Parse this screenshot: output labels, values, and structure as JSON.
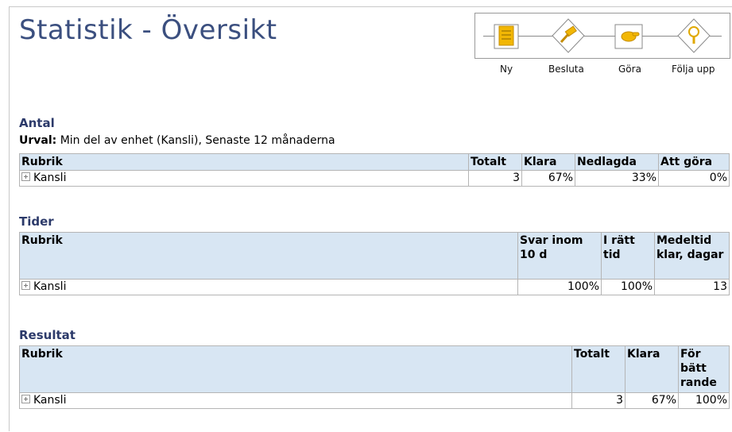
{
  "page": {
    "title": "Statistik - Översikt"
  },
  "process": {
    "steps": [
      {
        "label": "Ny",
        "icon": "document-icon"
      },
      {
        "label": "Besluta",
        "icon": "gavel-icon"
      },
      {
        "label": "Göra",
        "icon": "hand-icon"
      },
      {
        "label": "Följa upp",
        "icon": "magnifier-icon"
      }
    ],
    "icon_color": "#f2b705"
  },
  "antal": {
    "title": "Antal",
    "selection_label": "Urval:",
    "selection_value": "Min del av enhet (Kansli), Senaste 12 månaderna",
    "headers": [
      "Rubrik",
      "Totalt",
      "Klara",
      "Nedlagda",
      "Att göra"
    ],
    "rows": [
      {
        "label": "Kansli",
        "values": [
          "3",
          "67%",
          "33%",
          "0%"
        ]
      }
    ]
  },
  "tider": {
    "title": "Tider",
    "headers": [
      "Rubrik",
      "Svar inom 10 d",
      "I rätt tid",
      "Medeltid klar, dagar"
    ],
    "rows": [
      {
        "label": "Kansli",
        "values": [
          "100%",
          "100%",
          "13"
        ]
      }
    ]
  },
  "resultat": {
    "title": "Resultat",
    "headers": [
      "Rubrik",
      "Totalt",
      "Klara",
      "För bätt rande"
    ],
    "rows": [
      {
        "label": "Kansli",
        "values": [
          "3",
          "67%",
          "100%"
        ]
      }
    ]
  },
  "colors": {
    "header_bg": "#d8e6f3",
    "title": "#3b4f7f",
    "section_title": "#2c3a6a"
  }
}
